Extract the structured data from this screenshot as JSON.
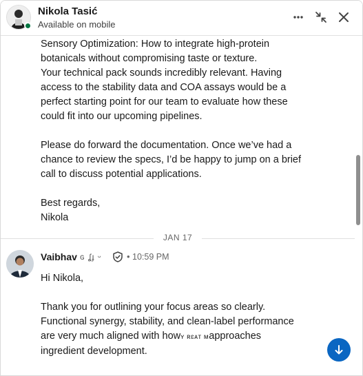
{
  "header": {
    "name": "Nikola Tasić",
    "status": "Available on mobile",
    "presence_color": "#057642",
    "icons": [
      "more-icon",
      "collapse-icon",
      "close-icon"
    ]
  },
  "thread": {
    "partial_lines": [
      "Sensory Optimization: How to integrate high-protein",
      "botanicals without compromising taste or texture.",
      "Your technical pack sounds incredibly relevant. Having",
      "access to the stability data and COA assays would be a",
      "perfect starting point for our team to evaluate how these",
      "could fit into our upcoming pipelines."
    ],
    "paragraph_2": [
      "Please do forward the documentation. Once we’ve had a",
      "chance to review the specs, I’d be happy to jump on a brief",
      "call to discuss potential applications."
    ],
    "signoff": [
      "Best regards,",
      "Nikola"
    ],
    "date_divider": "JAN 17",
    "message": {
      "sender": "Vaibhav",
      "sender_suffix": "ɢ ʆɟ ᵕ",
      "separator": "•",
      "time": "10:59 PM",
      "greeting": "Hi Nikola,",
      "lines": [
        "Thank you for outlining your focus areas so clearly.",
        "Functional synergy, stability, and clean-label performance"
      ],
      "line3_start": "are very much aligned with how",
      "line3_redacted": "ʏ ʀɛᴀᴛ ᴍ",
      "line3_end": "approaches",
      "line4": "ingredient development."
    }
  },
  "colors": {
    "accent": "#0a66c2",
    "text": "#191919",
    "muted": "#666666"
  }
}
